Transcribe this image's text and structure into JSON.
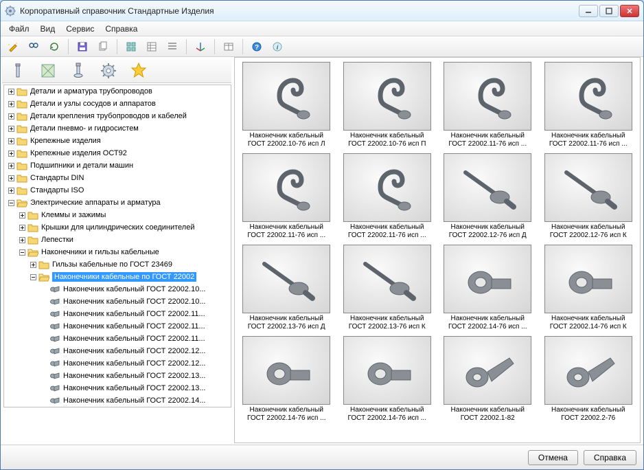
{
  "window": {
    "title": "Корпоративный справочник Стандартные Изделия"
  },
  "menubar": [
    {
      "label": "Файл"
    },
    {
      "label": "Вид"
    },
    {
      "label": "Сервис"
    },
    {
      "label": "Справка"
    }
  ],
  "tree": {
    "top": [
      "Детали и арматура трубопроводов",
      "Детали и узлы сосудов и аппаратов",
      "Детали крепления трубопроводов и кабелей",
      "Детали пневмо- и гидросистем",
      "Крепежные изделия",
      "Крепежные изделия ОСТ92",
      "Подшипники и детали машин",
      "Стандарты DIN",
      "Стандарты ISO"
    ],
    "elec": "Электрические аппараты и арматура",
    "elec_children": [
      "Клеммы и зажимы",
      "Крышки для цилиндрических соединителей",
      "Лепестки"
    ],
    "nak": "Наконечники и гильзы кабельные",
    "gilzy": "Гильзы кабельные по ГОСТ 23469",
    "selected": "Наконечники кабельные по ГОСТ 22002",
    "leaves": [
      "Наконечник кабельный ГОСТ 22002.10...",
      "Наконечник кабельный ГОСТ 22002.10...",
      "Наконечник кабельный ГОСТ 22002.11...",
      "Наконечник кабельный ГОСТ 22002.11...",
      "Наконечник кабельный ГОСТ 22002.11...",
      "Наконечник кабельный ГОСТ 22002.12...",
      "Наконечник кабельный ГОСТ 22002.12...",
      "Наконечник кабельный ГОСТ 22002.13...",
      "Наконечник кабельный ГОСТ 22002.13...",
      "Наконечник кабельный ГОСТ 22002.14..."
    ]
  },
  "thumbs": [
    {
      "label": "Наконечник кабельный ГОСТ 22002.10-76 исп Л",
      "shape": "hook"
    },
    {
      "label": "Наконечник кабельный ГОСТ 22002.10-76 исп П",
      "shape": "hook"
    },
    {
      "label": "Наконечник кабельный ГОСТ 22002.11-76 исп ...",
      "shape": "hook"
    },
    {
      "label": "Наконечник кабельный ГОСТ 22002.11-76 исп ...",
      "shape": "hook"
    },
    {
      "label": "Наконечник кабельный ГОСТ 22002.11-76 исп ...",
      "shape": "hook"
    },
    {
      "label": "Наконечник кабельный ГОСТ 22002.11-76 исп ...",
      "shape": "hook"
    },
    {
      "label": "Наконечник кабельный ГОСТ 22002.12-76 исп Д",
      "shape": "pin"
    },
    {
      "label": "Наконечник кабельный ГОСТ 22002.12-76 исп К",
      "shape": "pin"
    },
    {
      "label": "Наконечник кабельный ГОСТ 22002.13-76 исп Д",
      "shape": "pin"
    },
    {
      "label": "Наконечник кабельный ГОСТ 22002.13-76 исп К",
      "shape": "pin"
    },
    {
      "label": "Наконечник кабельный ГОСТ 22002.14-76 исп ...",
      "shape": "ring"
    },
    {
      "label": "Наконечник кабельный ГОСТ 22002.14-76 исп К",
      "shape": "ring"
    },
    {
      "label": "Наконечник кабельный ГОСТ 22002.14-76 исп ...",
      "shape": "ring"
    },
    {
      "label": "Наконечник кабельный ГОСТ 22002.14-76 исп ...",
      "shape": "ring"
    },
    {
      "label": "Наконечник кабельный ГОСТ 22002.1-82",
      "shape": "spade"
    },
    {
      "label": "Наконечник кабельный ГОСТ 22002.2-76",
      "shape": "spade"
    }
  ],
  "footer": {
    "cancel": "Отмена",
    "help": "Справка"
  }
}
